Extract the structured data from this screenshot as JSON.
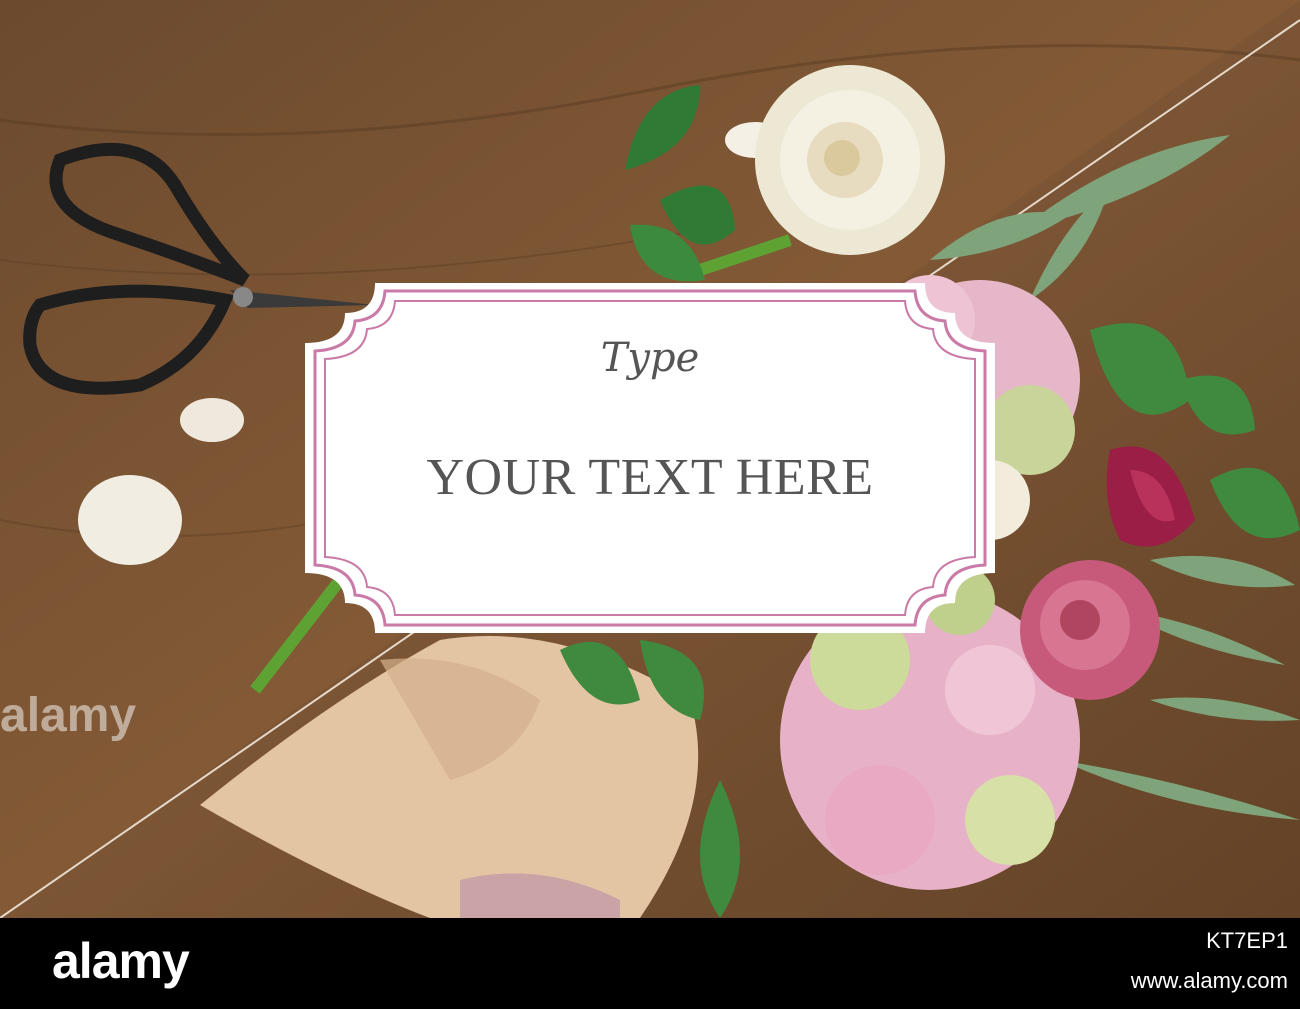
{
  "label": {
    "script_text": "Type",
    "main_text": "YOUR TEXT HERE"
  },
  "watermark": {
    "text": "alamy"
  },
  "footer": {
    "logo": "alamy",
    "image_id": "KT7EP1",
    "url": "www.alamy.com"
  },
  "colors": {
    "frame_pink": "#c97aa6",
    "wood": "#7a5535",
    "footer_bg": "#000000"
  }
}
